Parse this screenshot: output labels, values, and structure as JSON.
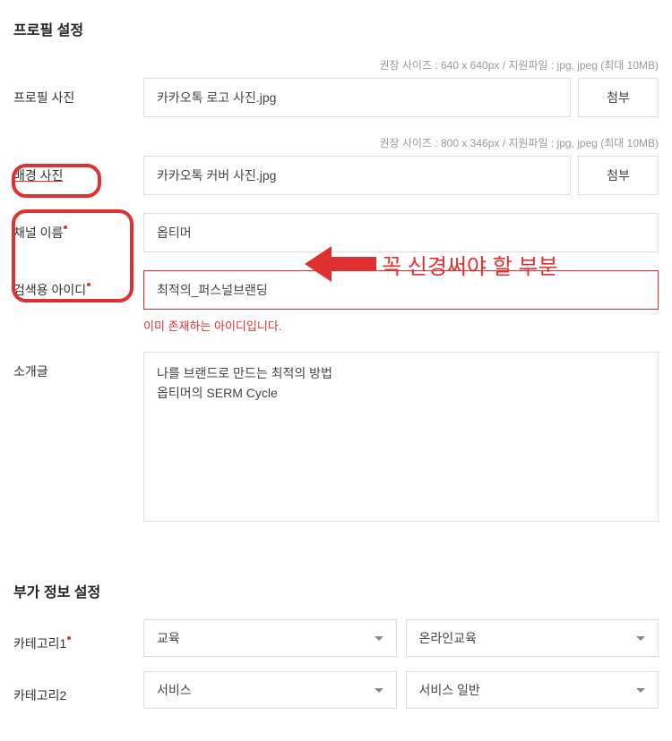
{
  "sections": {
    "profile": {
      "title": "프로필 설정",
      "profilePhoto": {
        "label": "프로필 사진",
        "hint": "권장 사이즈 : 640 x 640px / 지원파일 : jpg, jpeg (최대 10MB)",
        "value": "카카오톡 로고 사진.jpg",
        "attachLabel": "첨부"
      },
      "coverPhoto": {
        "label": "배경 사진",
        "hint": "권장 사이즈 : 800 x 346px / 지원파일 : jpg, jpeg (최대 10MB)",
        "value": "카카오톡 커버 사진.jpg",
        "attachLabel": "첨부"
      },
      "channelName": {
        "label": "채널 이름",
        "value": "옵티머"
      },
      "searchId": {
        "label": "검색용 아이디",
        "value": "최적의_퍼스널브랜딩",
        "errorMsg": "이미 존재하는 아이디입니다."
      },
      "intro": {
        "label": "소개글",
        "value": "나를 브랜드로 만드는 최적의 방법\n옵티머의 SERM Cycle"
      }
    },
    "additional": {
      "title": "부가 정보 설정",
      "category1": {
        "label": "카테고리1",
        "main": "교육",
        "sub": "온라인교육"
      },
      "category2": {
        "label": "카테고리2",
        "main": "서비스",
        "sub": "서비스 일반"
      }
    }
  },
  "annotation": {
    "text": "꼭 신경써야 할 부분"
  }
}
